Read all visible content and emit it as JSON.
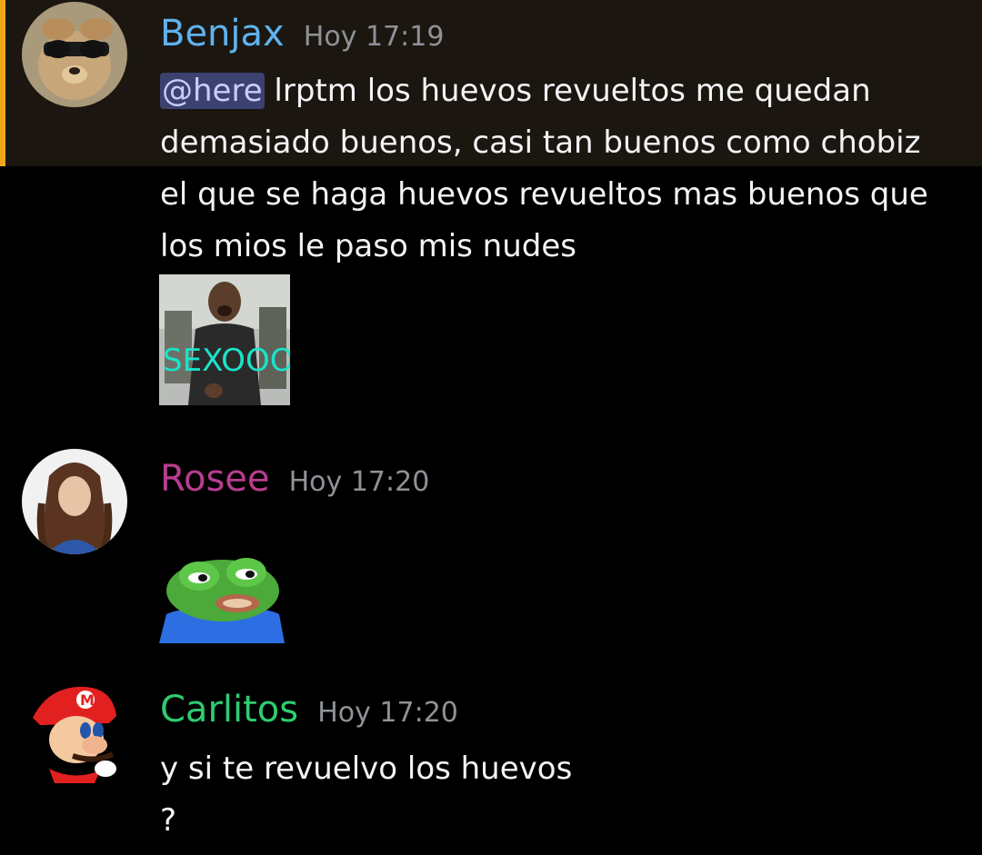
{
  "messages": [
    {
      "username": "Benjax",
      "username_color": "#5fb2ee",
      "timestamp": "Hoy 17:19",
      "mention": "@here",
      "text_line1": " lrptm los huevos revueltos me quedan",
      "text_line2": "demasiado buenos, casi tan buenos como chobiz",
      "text_line3": "el que se haga huevos revueltos mas buenos que",
      "text_line4": "los mios le paso mis nudes",
      "attachment_caption": "SEXOOO",
      "highlighted": true,
      "highlight_color": "#f0a61b"
    },
    {
      "username": "Rosee",
      "username_color": "#b93d8e",
      "timestamp": "Hoy 17:20",
      "sticker": "pepe-frog-sticker"
    },
    {
      "username": "Carlitos",
      "username_color": "#2ecc71",
      "timestamp": "Hoy 17:20",
      "text_line1": "y si te revuelvo los huevos",
      "text_line2": "?"
    }
  ]
}
